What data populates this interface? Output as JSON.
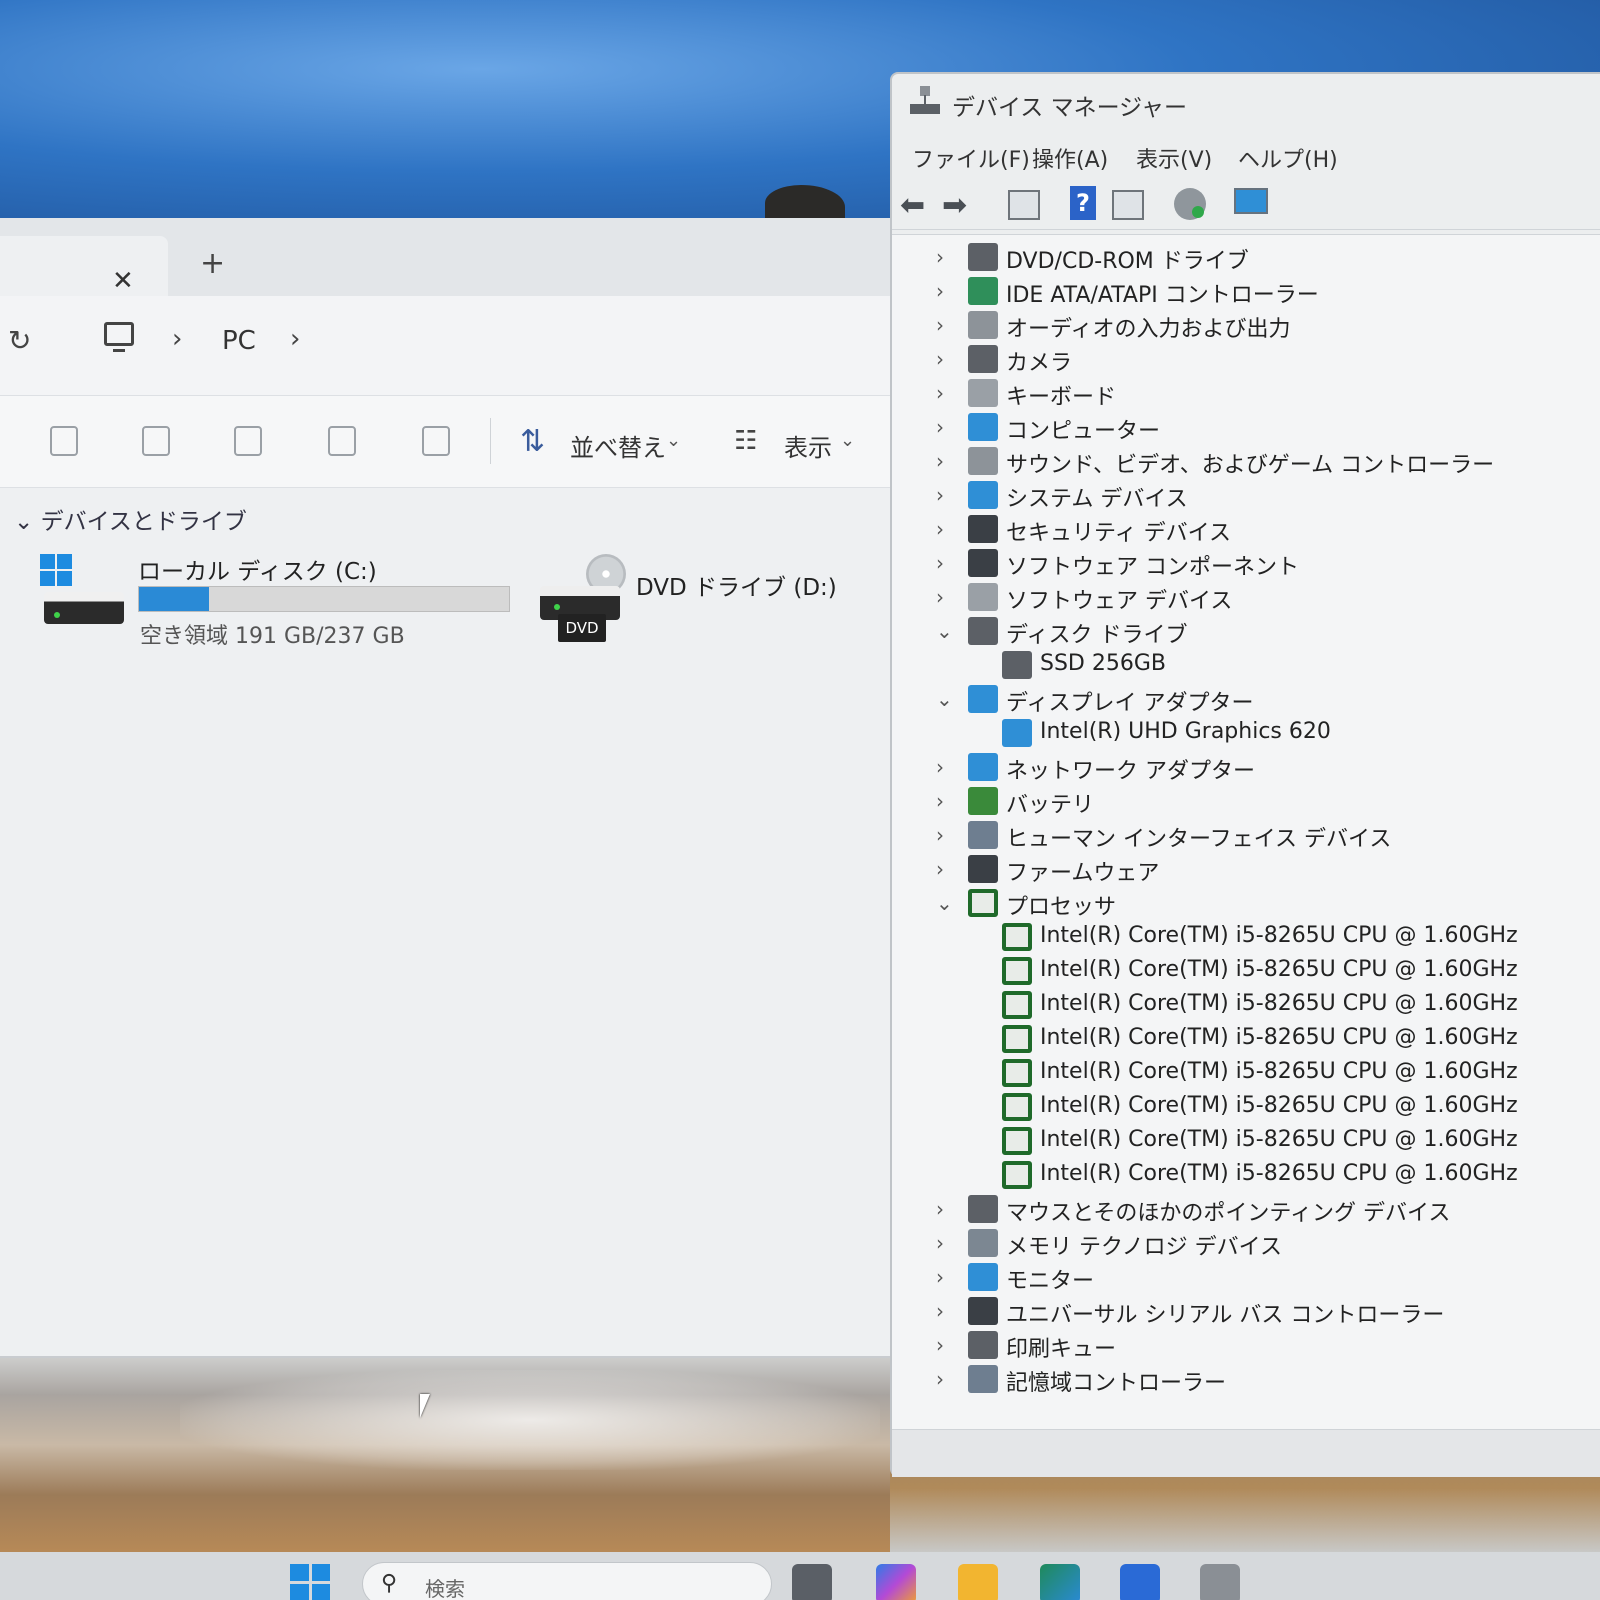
{
  "explorer": {
    "address": {
      "location": "PC"
    },
    "toolbar": {
      "sort_label": "並べ替え",
      "view_label": "表示"
    },
    "section_title": "デバイスとドライブ",
    "drives": [
      {
        "name": "ローカル ディスク (C:)",
        "space_text": "空き領域 191 GB/237 GB",
        "used_fraction": 0.19
      },
      {
        "name": "DVD ドライブ (D:)",
        "badge": "DVD"
      }
    ]
  },
  "device_manager": {
    "title": "デバイス マネージャー",
    "menu": [
      "ファイル(F)",
      "操作(A)",
      "表示(V)",
      "ヘルプ(H)"
    ],
    "tree": [
      {
        "label": "DVD/CD-ROM ドライブ",
        "expanded": false,
        "icon": "optical-drive-icon",
        "color": "#5c6066"
      },
      {
        "label": "IDE ATA/ATAPI コントローラー",
        "expanded": false,
        "icon": "ide-controller-icon",
        "color": "#2f8f5a"
      },
      {
        "label": "オーディオの入力および出力",
        "expanded": false,
        "icon": "speaker-icon",
        "color": "#8d9399"
      },
      {
        "label": "カメラ",
        "expanded": false,
        "icon": "camera-icon",
        "color": "#5c6066"
      },
      {
        "label": "キーボード",
        "expanded": false,
        "icon": "keyboard-icon",
        "color": "#9aa0a6"
      },
      {
        "label": "コンピューター",
        "expanded": false,
        "icon": "computer-icon",
        "color": "#2f8fd6"
      },
      {
        "label": "サウンド、ビデオ、およびゲーム コントローラー",
        "expanded": false,
        "icon": "speaker-icon",
        "color": "#8d9399"
      },
      {
        "label": "システム デバイス",
        "expanded": false,
        "icon": "system-devices-icon",
        "color": "#2f8fd6"
      },
      {
        "label": "セキュリティ デバイス",
        "expanded": false,
        "icon": "security-key-icon",
        "color": "#3a3f45"
      },
      {
        "label": "ソフトウェア コンポーネント",
        "expanded": false,
        "icon": "software-component-icon",
        "color": "#3a3f45"
      },
      {
        "label": "ソフトウェア デバイス",
        "expanded": false,
        "icon": "software-device-icon",
        "color": "#9aa0a6"
      },
      {
        "label": "ディスク ドライブ",
        "expanded": true,
        "icon": "disk-drive-icon",
        "color": "#5c6066"
      },
      {
        "label": "SSD 256GB",
        "child": true,
        "icon": "disk-drive-icon",
        "color": "#5c6066"
      },
      {
        "label": "ディスプレイ アダプター",
        "expanded": true,
        "icon": "display-adapter-icon",
        "color": "#2f8fd6"
      },
      {
        "label": "Intel(R) UHD Graphics 620",
        "child": true,
        "icon": "display-adapter-icon",
        "color": "#2f8fd6"
      },
      {
        "label": "ネットワーク アダプター",
        "expanded": false,
        "icon": "network-adapter-icon",
        "color": "#2f8fd6"
      },
      {
        "label": "バッテリ",
        "expanded": false,
        "icon": "battery-icon",
        "color": "#3a8a3a"
      },
      {
        "label": "ヒューマン インターフェイス デバイス",
        "expanded": false,
        "icon": "hid-icon",
        "color": "#6e7e90"
      },
      {
        "label": "ファームウェア",
        "expanded": false,
        "icon": "firmware-icon",
        "color": "#3a3f45"
      },
      {
        "label": "プロセッサ",
        "expanded": true,
        "icon": "cpu-icon",
        "color": "#1f6a2a"
      },
      {
        "label": "Intel(R) Core(TM) i5-8265U CPU @ 1.60GHz",
        "child": true,
        "icon": "cpu-icon",
        "color": "#1f6a2a"
      },
      {
        "label": "Intel(R) Core(TM) i5-8265U CPU @ 1.60GHz",
        "child": true,
        "icon": "cpu-icon",
        "color": "#1f6a2a"
      },
      {
        "label": "Intel(R) Core(TM) i5-8265U CPU @ 1.60GHz",
        "child": true,
        "icon": "cpu-icon",
        "color": "#1f6a2a"
      },
      {
        "label": "Intel(R) Core(TM) i5-8265U CPU @ 1.60GHz",
        "child": true,
        "icon": "cpu-icon",
        "color": "#1f6a2a"
      },
      {
        "label": "Intel(R) Core(TM) i5-8265U CPU @ 1.60GHz",
        "child": true,
        "icon": "cpu-icon",
        "color": "#1f6a2a"
      },
      {
        "label": "Intel(R) Core(TM) i5-8265U CPU @ 1.60GHz",
        "child": true,
        "icon": "cpu-icon",
        "color": "#1f6a2a"
      },
      {
        "label": "Intel(R) Core(TM) i5-8265U CPU @ 1.60GHz",
        "child": true,
        "icon": "cpu-icon",
        "color": "#1f6a2a"
      },
      {
        "label": "Intel(R) Core(TM) i5-8265U CPU @ 1.60GHz",
        "child": true,
        "icon": "cpu-icon",
        "color": "#1f6a2a"
      },
      {
        "label": "マウスとそのほかのポインティング デバイス",
        "expanded": false,
        "icon": "mouse-icon",
        "color": "#5c6066"
      },
      {
        "label": "メモリ テクノロジ デバイス",
        "expanded": false,
        "icon": "memory-icon",
        "color": "#7c8792"
      },
      {
        "label": "モニター",
        "expanded": false,
        "icon": "monitor-icon",
        "color": "#2f8fd6"
      },
      {
        "label": "ユニバーサル シリアル バス コントローラー",
        "expanded": false,
        "icon": "usb-icon",
        "color": "#3a3f45"
      },
      {
        "label": "印刷キュー",
        "expanded": false,
        "icon": "printer-icon",
        "color": "#5c6066"
      },
      {
        "label": "記憶域コントローラー",
        "expanded": false,
        "icon": "storage-controller-icon",
        "color": "#6e7e90"
      }
    ]
  },
  "taskbar": {
    "search_placeholder": "検索"
  }
}
